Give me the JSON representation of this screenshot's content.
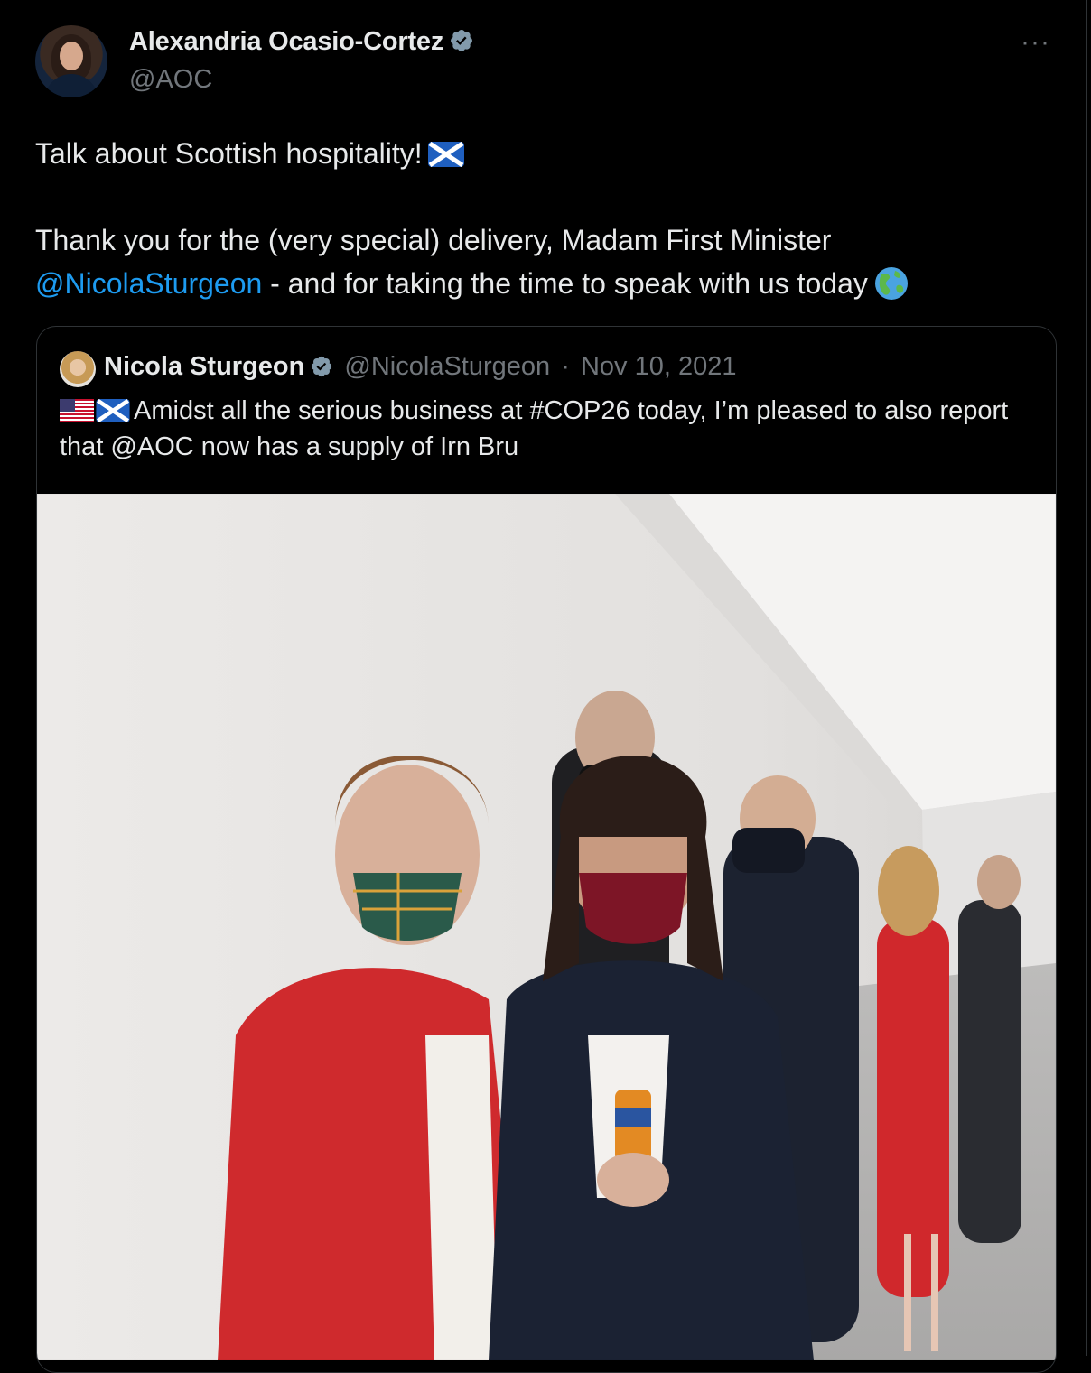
{
  "tweet": {
    "author": {
      "name": "Alexandria Ocasio-Cortez",
      "handle": "@AOC"
    },
    "more_label": "···",
    "line1": "Talk about Scottish hospitality!",
    "line2": "Thank you for the (very special) delivery, Madam First Minister",
    "mention": "@NicolaSturgeon",
    "line3": " - and for taking the time to speak with us today"
  },
  "quote": {
    "name": "Nicola Sturgeon",
    "handle": "@NicolaSturgeon",
    "separator": "·",
    "date": "Nov 10, 2021",
    "text": "Amidst all the serious business at #COP26 today, I’m pleased to also report that @AOC now has a supply of Irn Bru"
  },
  "icons": {
    "verified": "verified-badge-icon",
    "scotland_flag": "scotland-flag-icon",
    "us_flag": "us-flag-icon",
    "globe": "globe-americas-icon"
  },
  "colors": {
    "background": "#000000",
    "text": "#e7e9ea",
    "muted": "#71767b",
    "link": "#1d9bf0",
    "border": "#2f3336"
  }
}
